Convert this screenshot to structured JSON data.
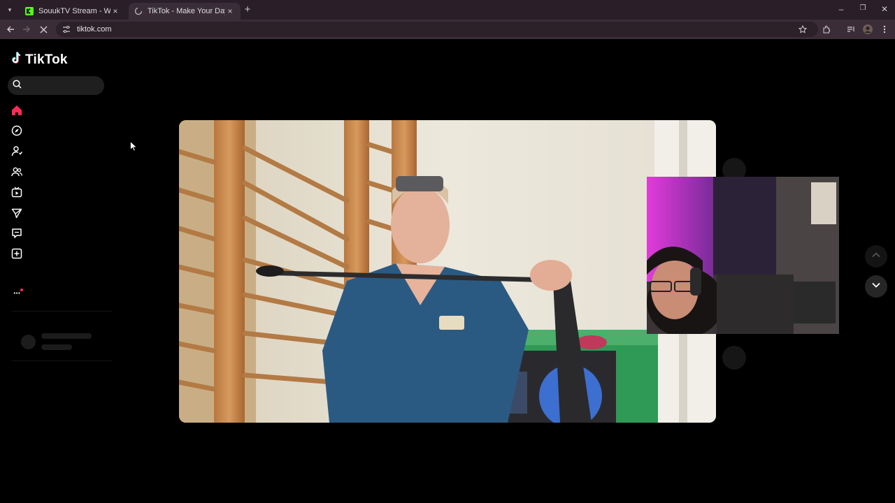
{
  "browser": {
    "tabs": [
      {
        "title": "SouukTV Stream - Watch Live o",
        "favicon": "kick-icon",
        "favicon_color": "#53fc18"
      },
      {
        "title": "TikTok - Make Your Day",
        "favicon": "loading-spinner-icon",
        "active": true
      }
    ],
    "new_tab_label": "+",
    "url": "tiktok.com",
    "window_controls": {
      "minimize": "–",
      "restore": "❐",
      "close": "✕"
    }
  },
  "tiktok": {
    "brand": "TikTok",
    "accent_color": "#fe2c55",
    "search": {
      "placeholder": "",
      "value": ""
    },
    "nav_icons": [
      "home-icon",
      "explore-icon",
      "following-icon",
      "friends-icon",
      "live-icon",
      "messages-icon",
      "activity-icon",
      "upload-icon",
      "more-icon"
    ],
    "more_label": "···"
  }
}
